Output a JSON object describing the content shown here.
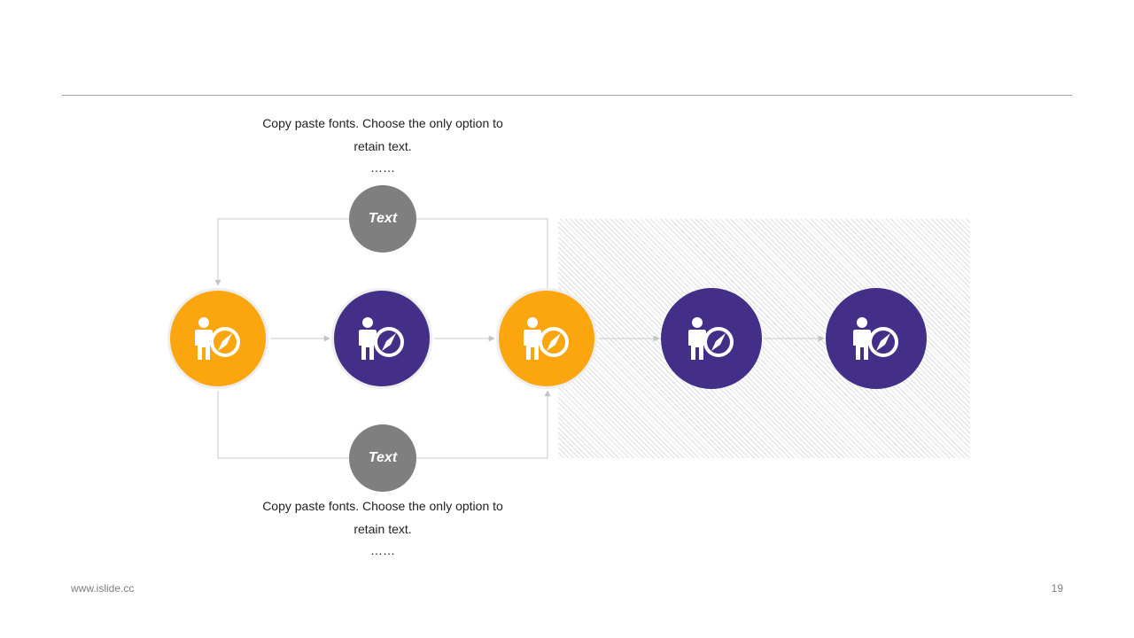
{
  "top_caption": {
    "line1": "Copy paste fonts. Choose the only option to",
    "line2": "retain text.",
    "ellipsis": "……"
  },
  "bottom_caption": {
    "line1": "Copy paste fonts. Choose the only option to",
    "line2": "retain text.",
    "ellipsis": "……"
  },
  "labels": {
    "top": "Text",
    "bottom": "Text"
  },
  "nodes": [
    {
      "color": "orange",
      "icon": "businessman-compass-icon"
    },
    {
      "color": "purple",
      "icon": "businessman-compass-icon"
    },
    {
      "color": "orange",
      "icon": "businessman-compass-icon"
    },
    {
      "color": "purple",
      "icon": "businessman-compass-icon"
    },
    {
      "color": "purple",
      "icon": "businessman-compass-icon"
    }
  ],
  "colors": {
    "orange": "#fba60f",
    "purple": "#432f87",
    "gray": "#7f7f7f"
  },
  "footer": {
    "website": "www.islide.cc",
    "page_number": "19"
  }
}
